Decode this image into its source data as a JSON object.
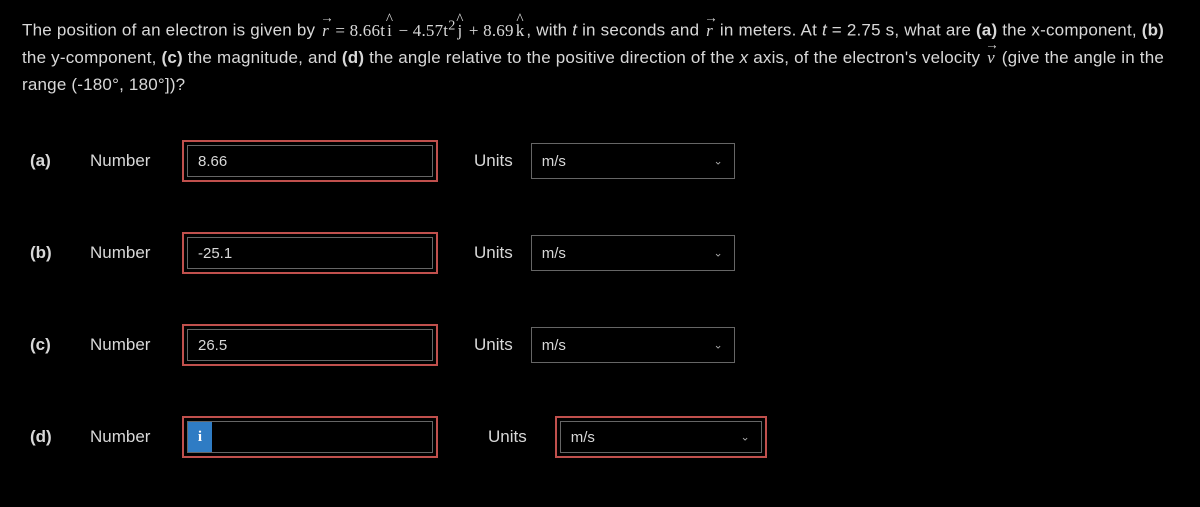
{
  "problem": {
    "intro": "The position of an electron is given by ",
    "eq_r": "r",
    "eq_equals": " = ",
    "eq_term1": "8.66t",
    "eq_i": "i",
    "eq_minus": " − 4.57t",
    "eq_exp2": "2",
    "eq_j": "j",
    "eq_plus": " + 8.69",
    "eq_k": "k",
    "after_eq_a": ", with ",
    "t_var": "t",
    "after_eq_b": " in seconds and ",
    "eq_r2": "r",
    "after_eq_c": " in meters. At ",
    "t_eq": "t",
    "t_val": " = 2.75 s, what are ",
    "part_a": "(a)",
    "after_a": " the x-component, ",
    "part_b": "(b)",
    "after_b": " the y-component, ",
    "part_c": "(c)",
    "after_c": " the magnitude, and ",
    "part_d": "(d)",
    "after_d": " the angle relative to the positive direction of the ",
    "x_ax": "x",
    "after_x": " axis, of the electron's velocity ",
    "eq_v": "v",
    "tail": " (give the angle in the range (-180°, 180°])?"
  },
  "labels": {
    "number": "Number",
    "units": "Units",
    "info": "i"
  },
  "parts": [
    {
      "id": "(a)",
      "value": "8.66",
      "unit": "m/s",
      "info": false,
      "unitRed": false
    },
    {
      "id": "(b)",
      "value": "-25.1",
      "unit": "m/s",
      "info": false,
      "unitRed": false
    },
    {
      "id": "(c)",
      "value": "26.5",
      "unit": "m/s",
      "info": false,
      "unitRed": false
    },
    {
      "id": "(d)",
      "value": "",
      "unit": "m/s",
      "info": true,
      "unitRed": true
    }
  ],
  "unit_options": [
    "m/s"
  ]
}
